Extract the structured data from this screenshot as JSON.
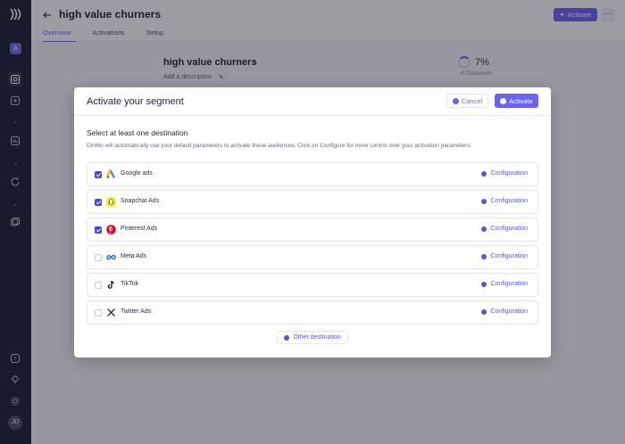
{
  "header": {
    "title": "high value churners",
    "activate_label": "Activate",
    "more_label": "···",
    "tabs": [
      {
        "label": "Overview",
        "active": true
      },
      {
        "label": "Activations",
        "active": false
      },
      {
        "label": "Setup",
        "active": false
      }
    ]
  },
  "sidebar": {
    "workspace_initial": "A",
    "user_initials": "JD"
  },
  "segment": {
    "name": "high value churners",
    "description_placeholder": "Add a description",
    "stat_value": "7%",
    "stat_label": "of Customers"
  },
  "modal": {
    "title": "Activate your segment",
    "cancel_label": "Cancel",
    "activate_label": "Activate",
    "section_title": "Select at least one destination",
    "section_desc": "DinMo will automatically use your default parameters to activate these audiences. Click on Configure for more control over your activation parameters.",
    "config_label": "Configuration",
    "other_label": "Other destination",
    "destinations": [
      {
        "name": "Google ads",
        "checked": true,
        "icon": "google-ads-icon"
      },
      {
        "name": "Snapchat Ads",
        "checked": true,
        "icon": "snapchat-icon"
      },
      {
        "name": "Pinterest Ads",
        "checked": true,
        "icon": "pinterest-icon"
      },
      {
        "name": "Meta Ads",
        "checked": false,
        "icon": "meta-icon"
      },
      {
        "name": "TikTok",
        "checked": false,
        "icon": "tiktok-icon"
      },
      {
        "name": "Twitter Ads",
        "checked": false,
        "icon": "x-icon"
      }
    ]
  },
  "colors": {
    "accent": "#6c63f5",
    "sidebar_bg": "#1c2033"
  }
}
